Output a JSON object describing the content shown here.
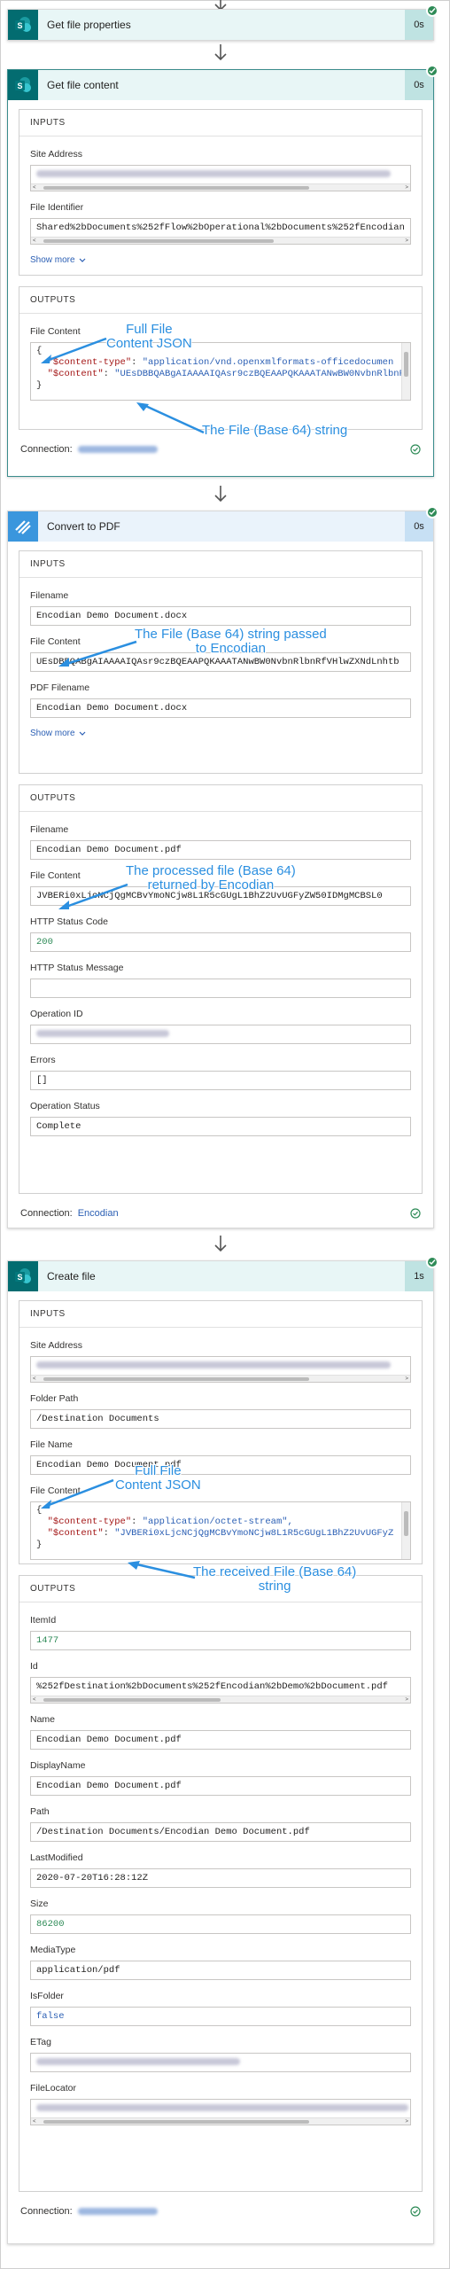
{
  "colors": {
    "sharepoint": "#036c70",
    "encodian": "#3a96dd",
    "success": "#2e8b57",
    "link": "#2b5fb4",
    "annotation": "#2b8fe0"
  },
  "step1": {
    "title": "Get file properties",
    "time": "0s",
    "icon": "sharepoint-icon"
  },
  "step2": {
    "title": "Get file content",
    "time": "0s",
    "icon": "sharepoint-icon",
    "inputs_label": "INPUTS",
    "site_address_label": "Site Address",
    "file_identifier_label": "File Identifier",
    "file_identifier_value": "Shared%2bDocuments%252fFlow%2bOperational%2bDocuments%252fEncodian",
    "show_more": "Show more",
    "outputs_label": "OUTPUTS",
    "file_content_label": "File Content",
    "json_open": "{",
    "json_line1_key": "\"$content-type\"",
    "json_line1_val": "\"application/vnd.openxmlformats-officedocumen",
    "json_line2_key": "\"$content\"",
    "json_line2_val": "\"UEsDBBQABgAIAAAAIQAsr9czBQEAAPQKAAATANwBW0NvbnRlbnR",
    "json_close": "}",
    "connection_label": "Connection:"
  },
  "step3": {
    "title": "Convert to PDF",
    "time": "0s",
    "icon": "encodian-icon",
    "inputs_label": "INPUTS",
    "filename_label": "Filename",
    "filename_value": "Encodian Demo Document.docx",
    "file_content_label": "File Content",
    "file_content_value": "UEsDBBQABgAIAAAAIQAsr9czBQEAAPQKAAATANwBW0NvbnRlbnRfVHlwZXNdLnhtb",
    "pdf_filename_label": "PDF Filename",
    "pdf_filename_value": "Encodian Demo Document.docx",
    "show_more": "Show more",
    "outputs_label": "OUTPUTS",
    "out_filename_label": "Filename",
    "out_filename_value": "Encodian Demo Document.pdf",
    "out_file_content_label": "File Content",
    "out_file_content_value": "JVBERi0xLjcNCjQgMCBvYmoNCjw8L1R5cGUgL1BhZ2UvUGFyZW50IDMgMCBSL0",
    "http_status_code_label": "HTTP Status Code",
    "http_status_code_value": "200",
    "http_status_message_label": "HTTP Status Message",
    "operation_id_label": "Operation ID",
    "errors_label": "Errors",
    "errors_value": "[]",
    "operation_status_label": "Operation Status",
    "operation_status_value": "Complete",
    "connection_label": "Connection:",
    "connection_value": "Encodian"
  },
  "step4": {
    "title": "Create file",
    "time": "1s",
    "icon": "sharepoint-icon",
    "inputs_label": "INPUTS",
    "site_address_label": "Site Address",
    "folder_path_label": "Folder Path",
    "folder_path_value": "/Destination Documents",
    "file_name_label": "File Name",
    "file_name_value": "Encodian Demo Document.pdf",
    "file_content_label": "File Content",
    "json_open": "{",
    "json_line1_key": "\"$content-type\"",
    "json_line1_val": "\"application/octet-stream\",",
    "json_line2_key": "\"$content\"",
    "json_line2_val": "\"JVBERi0xLjcNCjQgMCBvYmoNCjw8L1R5cGUgL1BhZ2UvUGFyZ",
    "json_close": "}",
    "outputs_label": "OUTPUTS",
    "itemid_label": "ItemId",
    "itemid_value": "1477",
    "id_label": "Id",
    "id_value": "%252fDestination%2bDocuments%252fEncodian%2bDemo%2bDocument.pdf",
    "name_label": "Name",
    "name_value": "Encodian Demo Document.pdf",
    "displayname_label": "DisplayName",
    "displayname_value": "Encodian Demo Document.pdf",
    "path_label": "Path",
    "path_value": "/Destination Documents/Encodian Demo Document.pdf",
    "lastmodified_label": "LastModified",
    "lastmodified_value": "2020-07-20T16:28:12Z",
    "size_label": "Size",
    "size_value": "86200",
    "mediatype_label": "MediaType",
    "mediatype_value": "application/pdf",
    "isfolder_label": "IsFolder",
    "isfolder_value": "false",
    "etag_label": "ETag",
    "filelocator_label": "FileLocator",
    "connection_label": "Connection:"
  },
  "annotations": {
    "a1_line1": "Full File",
    "a1_line2": "Content JSON",
    "a2": "The File (Base 64) string",
    "a3_line1": "The File (Base 64) string passed",
    "a3_line2": "to Encodian",
    "a4_line1": "The processed file (Base 64)",
    "a4_line2": "returned by Encodian",
    "a5_line1": "Full File",
    "a5_line2": "Content JSON",
    "a6_line1": "The received File (Base 64)",
    "a6_line2": "string"
  }
}
